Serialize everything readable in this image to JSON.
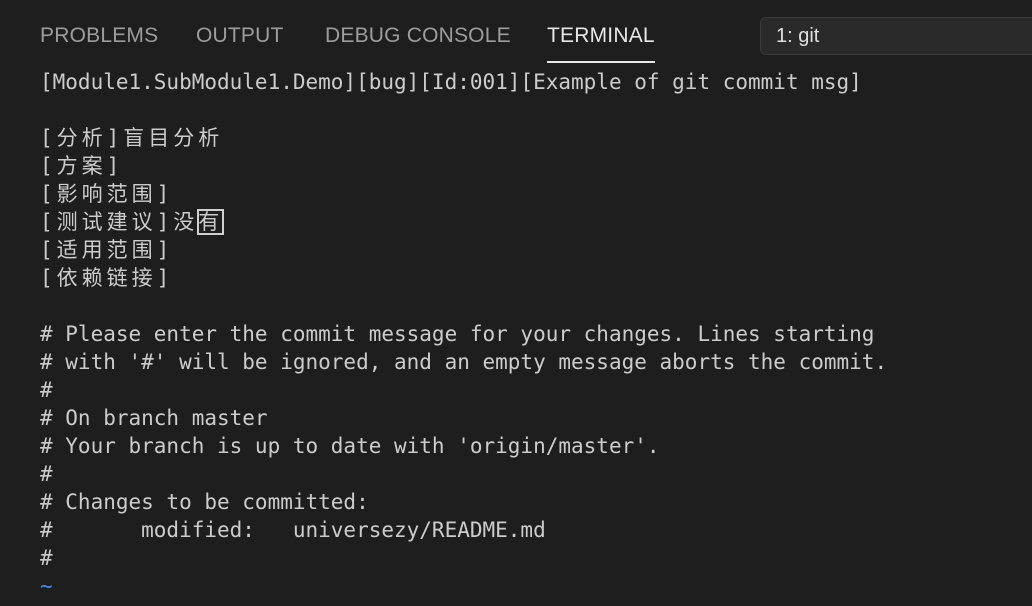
{
  "panel": {
    "tabs": [
      {
        "label": "PROBLEMS",
        "active": false
      },
      {
        "label": "OUTPUT",
        "active": false
      },
      {
        "label": "DEBUG CONSOLE",
        "active": false
      },
      {
        "label": "TERMINAL",
        "active": true
      }
    ],
    "terminal_selector": "1: git"
  },
  "terminal": {
    "header": "[Module1.SubModule1.Demo][bug][Id:001][Example of git commit msg]",
    "analysis": "[分析]盲目分析",
    "plan": "[方案]",
    "impact": "[影响范围]",
    "test_prefix": "[测试建议]没",
    "test_cursor_char": "有",
    "scope": "[适用范围]",
    "deps": "[依赖链接]",
    "comments": [
      "# Please enter the commit message for your changes. Lines starting",
      "# with '#' will be ignored, and an empty message aborts the commit.",
      "#",
      "# On branch master",
      "# Your branch is up to date with 'origin/master'.",
      "#",
      "# Changes to be committed:",
      "#       modified:   universezy/README.md",
      "#"
    ],
    "tilde": "~"
  },
  "colors": {
    "background": "#1e1e1e",
    "tab_inactive": "#9d9d9d",
    "tab_active": "#e7e7e7",
    "text": "#cccccc",
    "tilde": "#3b8eea"
  }
}
